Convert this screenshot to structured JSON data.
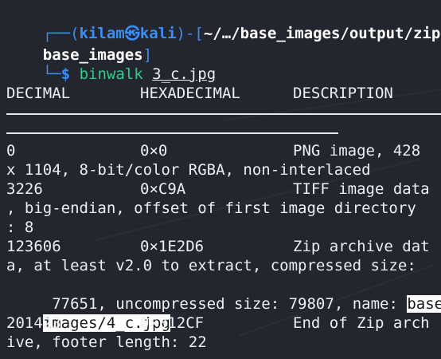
{
  "prompt": {
    "corner_top": "┌──(",
    "user": "kilam",
    "at_symbol": "㉿",
    "host": "kali",
    "close_paren": ")-[",
    "path_line1": "~/…/base_images/output/zip/",
    "path_line2": "base_images",
    "close_bracket": "]",
    "corner_bottom": "└─",
    "dollar": "$",
    "command": "binwalk",
    "argument": "3_c.jpg"
  },
  "table": {
    "headers": [
      "DECIMAL",
      "HEXADECIMAL",
      "DESCRIPTION"
    ],
    "rows": [
      {
        "decimal": "0",
        "hex": "0×0",
        "desc_first": "PNG image, 428",
        "desc_cont": [
          "x 1104, 8-bit/color RGBA, non-interlaced"
        ]
      },
      {
        "decimal": "3226",
        "hex": "0×C9A",
        "desc_first": "TIFF image data",
        "desc_cont": [
          ", big-endian, offset of first image directory",
          ": 8"
        ]
      },
      {
        "decimal": "123606",
        "hex": "0×1E2D6",
        "desc_first": "Zip archive dat",
        "desc_cont": [
          "a, at least v2.0 to extract, compressed size:",
          " 77651, uncompressed size: 79807, name: "
        ],
        "selected_a": "base_",
        "selected_b": "images/4_c.jpg"
      },
      {
        "decimal": "201423",
        "hex": "0×312CF",
        "desc_first": "End of Zip arch",
        "desc_cont": [
          "ive, footer length: 22"
        ]
      }
    ]
  }
}
